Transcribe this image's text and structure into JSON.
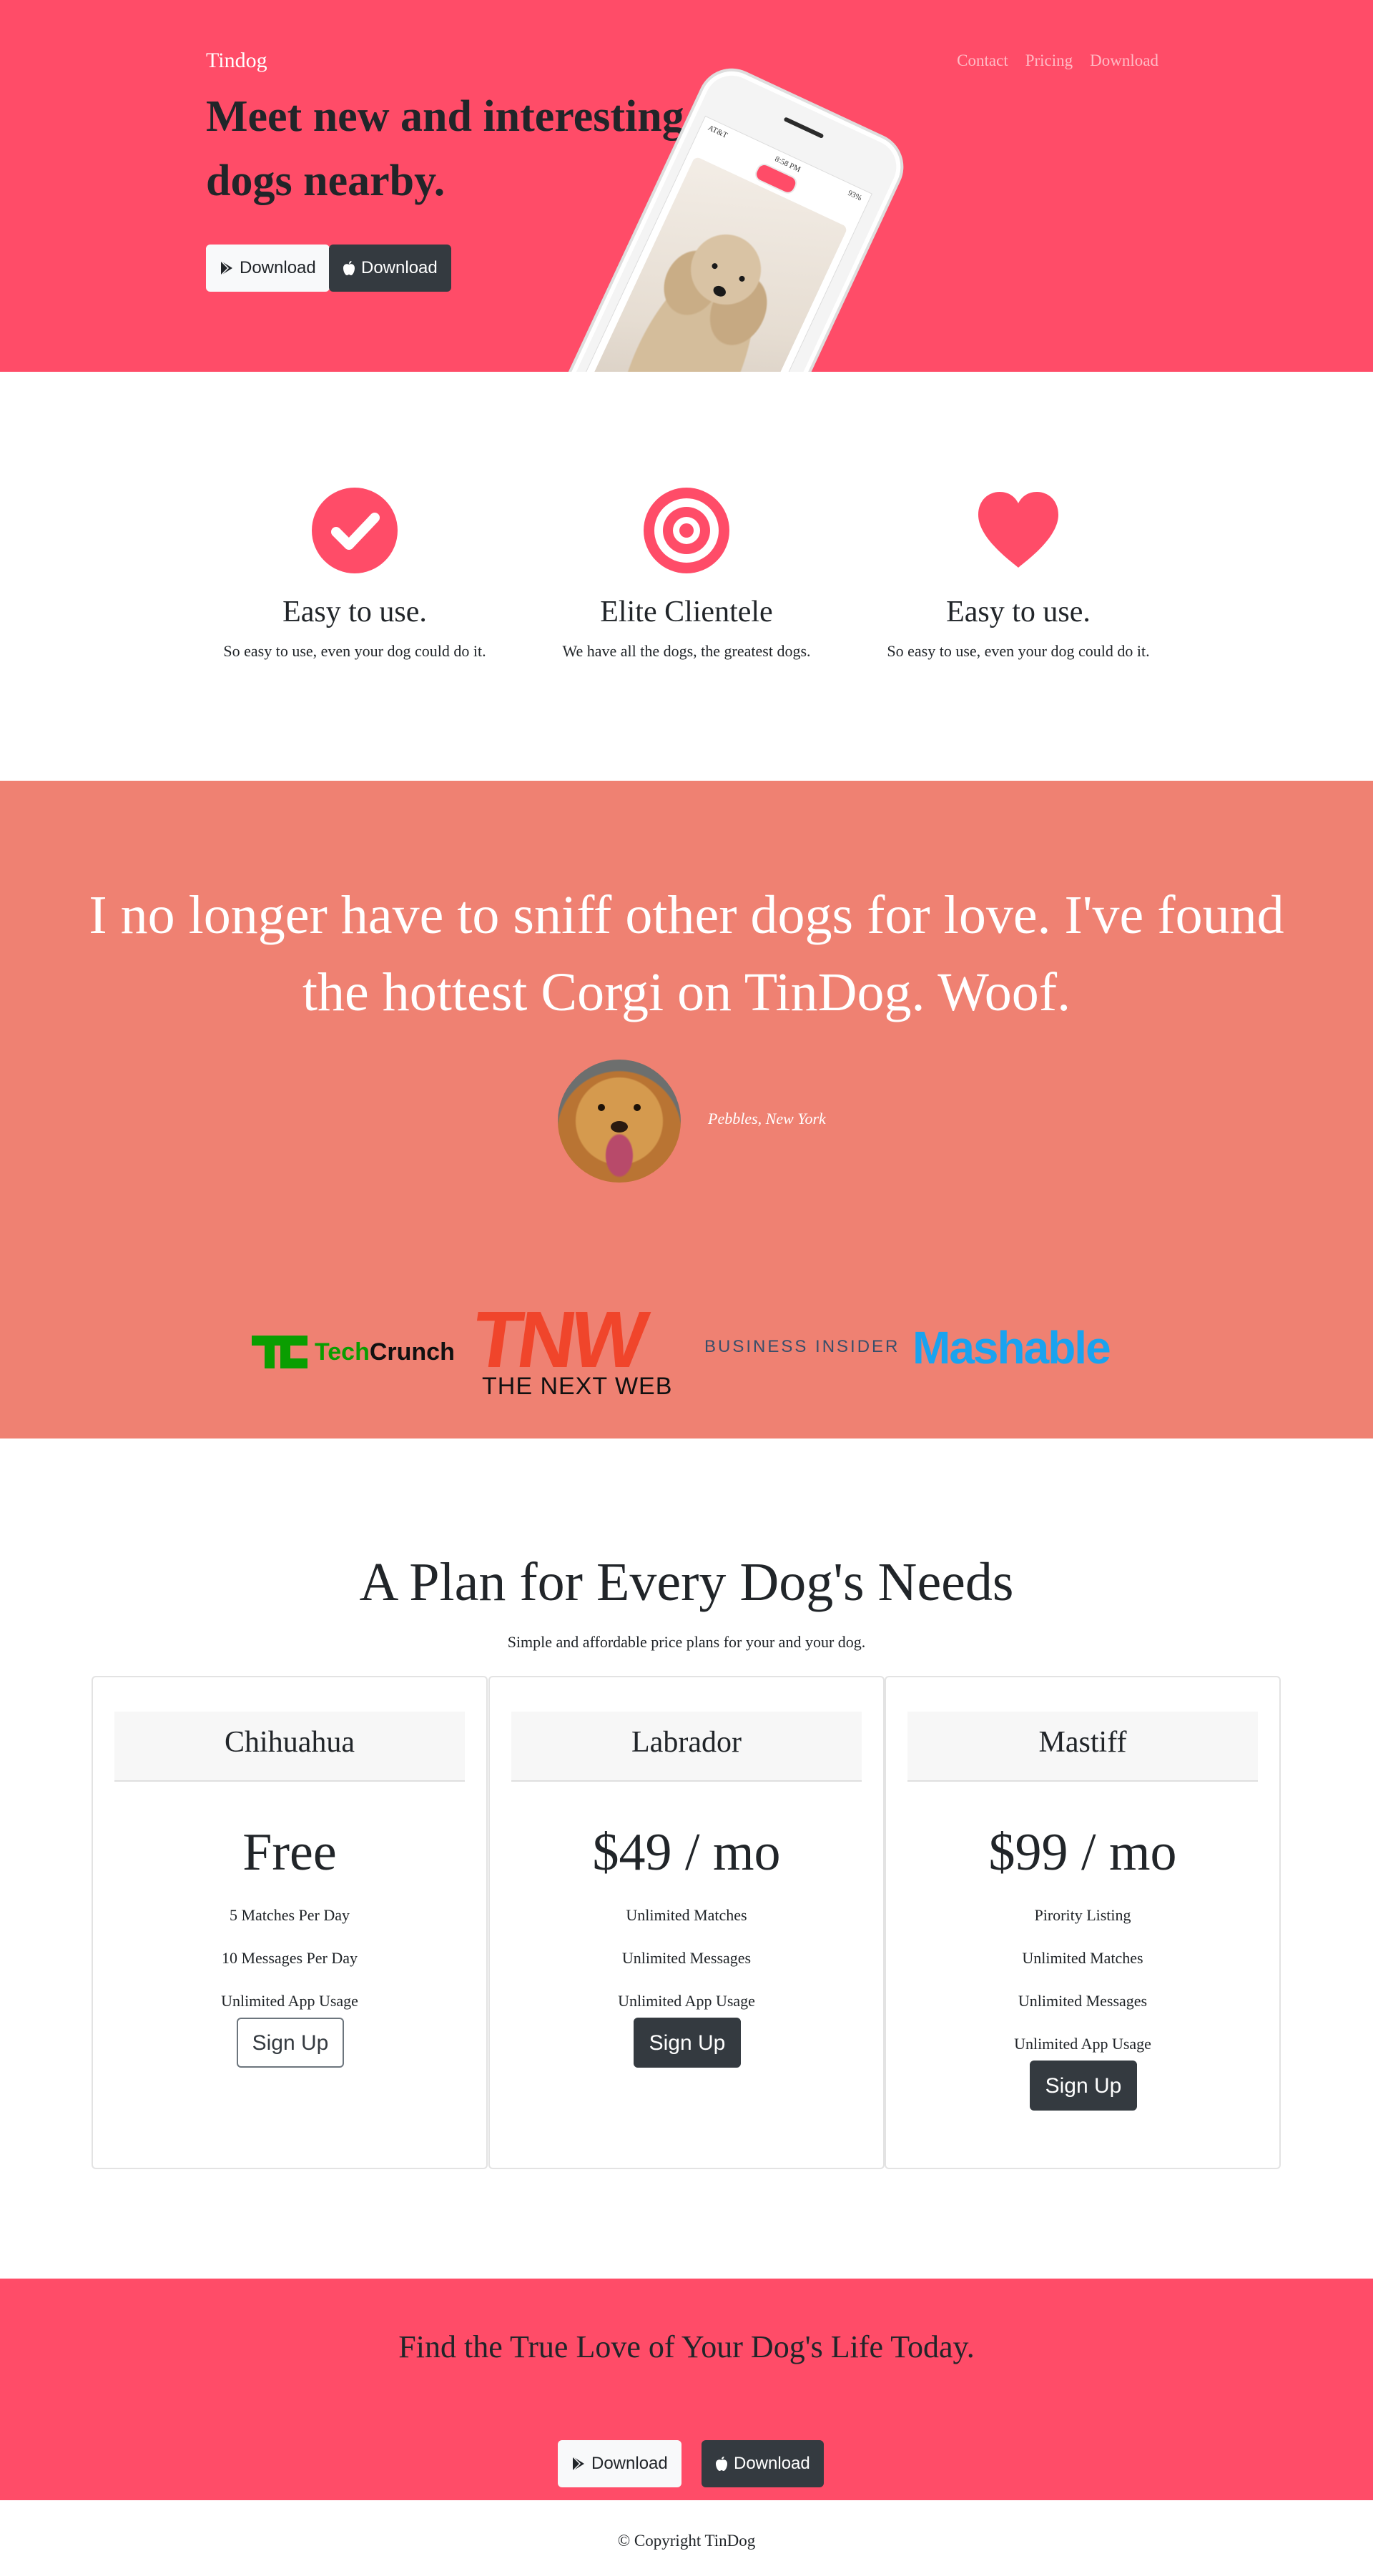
{
  "brand": "Tindog",
  "nav": [
    "Contact",
    "Pricing",
    "Download"
  ],
  "hero": {
    "heading": "Meet new and interesting dogs nearby.",
    "download_google": "Download",
    "download_apple": "Download",
    "phone_status": {
      "carrier": "AT&T",
      "time": "8:58 PM",
      "battery": "93%"
    }
  },
  "features": [
    {
      "icon": "check-circle-icon",
      "title": "Easy to use.",
      "text": "So easy to use, even your dog could do it."
    },
    {
      "icon": "bullseye-icon",
      "title": "Elite Clientele",
      "text": "We have all the dogs, the greatest dogs."
    },
    {
      "icon": "heart-icon",
      "title": "Easy to use.",
      "text": "So easy to use, even your dog could do it."
    }
  ],
  "testimonial": {
    "quote": "I no longer have to sniff other dogs for love. I've found the hottest Corgi on TinDog. Woof.",
    "caption": "Pebbles, New York"
  },
  "press": {
    "techcrunch_prefix": "Tech",
    "techcrunch_suffix": "Crunch",
    "tnw": "TNW",
    "tnw_sub": "THE NEXT WEB",
    "business_insider": "BUSINESS INSIDER",
    "mashable": "Mashable"
  },
  "pricing": {
    "title": "A Plan for Every Dog's Needs",
    "subtitle": "Simple and affordable price plans for your and your dog.",
    "plans": [
      {
        "name": "Chihuahua",
        "price": "Free",
        "features": [
          "5 Matches Per Day",
          "10 Messages Per Day",
          "Unlimited App Usage"
        ],
        "button": "Sign Up"
      },
      {
        "name": "Labrador",
        "price": "$49 / mo",
        "features": [
          "Unlimited Matches",
          "Unlimited Messages",
          "Unlimited App Usage"
        ],
        "button": "Sign Up"
      },
      {
        "name": "Mastiff",
        "price": "$99 / mo",
        "features": [
          "Pirority Listing",
          "Unlimited Matches",
          "Unlimited Messages",
          "Unlimited App Usage"
        ],
        "button": "Sign Up"
      }
    ]
  },
  "cta": {
    "heading": "Find the True Love of Your Dog's Life Today.",
    "download_google": "Download",
    "download_apple": "Download"
  },
  "footer": {
    "copyright": "© Copyright TinDog"
  },
  "colors": {
    "primary": "#ff4c68",
    "testimonial_bg": "#ef8172",
    "dark": "#343a40",
    "text": "#212529"
  }
}
